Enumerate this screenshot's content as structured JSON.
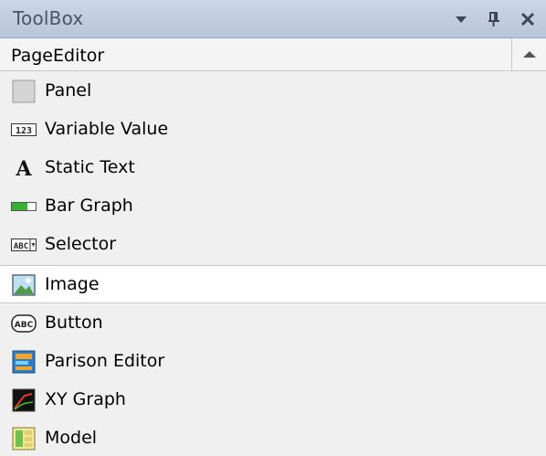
{
  "window": {
    "title": "ToolBox",
    "buttons": {
      "dropdown_icon": "chevron-down-icon",
      "pin_icon": "pin-icon",
      "close_icon": "close-icon"
    }
  },
  "category": {
    "label": "PageEditor",
    "collapse_icon": "collapse-up-icon"
  },
  "items": [
    {
      "label": "Panel",
      "icon": "panel-icon"
    },
    {
      "label": "Variable Value",
      "icon": "variable-value-icon"
    },
    {
      "label": "Static Text",
      "icon": "static-text-icon"
    },
    {
      "label": "Bar Graph",
      "icon": "bar-graph-icon"
    },
    {
      "label": "Selector",
      "icon": "selector-icon"
    },
    {
      "label": "Image",
      "icon": "image-icon",
      "selected": true
    },
    {
      "label": "Button",
      "icon": "button-icon"
    },
    {
      "label": "Parison Editor",
      "icon": "parison-editor-icon"
    },
    {
      "label": "XY Graph",
      "icon": "xy-graph-icon"
    },
    {
      "label": "Model",
      "icon": "model-icon"
    }
  ],
  "colors": {
    "titlebar": "#bfcbdd",
    "selected_row": "#ffffff",
    "background": "#f0f0f0"
  }
}
